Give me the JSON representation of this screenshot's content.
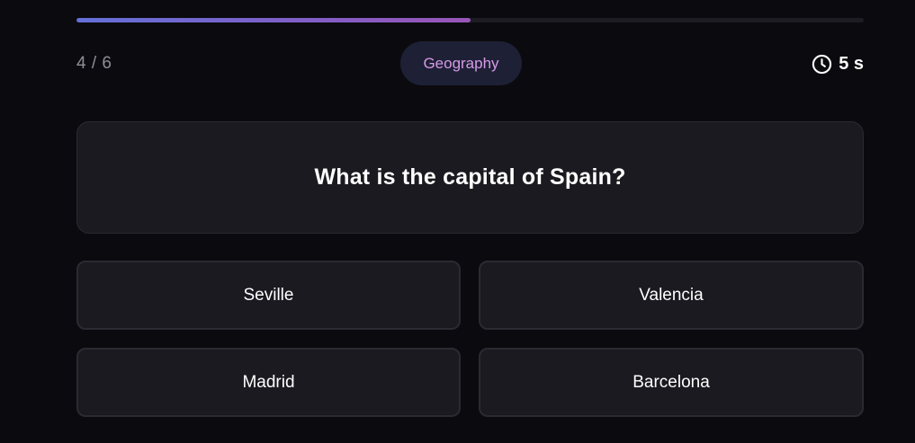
{
  "progress": {
    "current": 4,
    "total": 6,
    "fraction": 0.5
  },
  "header": {
    "counter_text": "4 / 6",
    "category": "Geography",
    "timer_text": "5 s",
    "timer_icon": "clock-icon"
  },
  "question": {
    "text": "What is the capital of Spain?"
  },
  "answers": [
    {
      "label": "Seville"
    },
    {
      "label": "Valencia"
    },
    {
      "label": "Madrid"
    },
    {
      "label": "Barcelona"
    }
  ],
  "colors": {
    "background": "#0b0b0f",
    "card": "#1a1a20",
    "pill_bg": "#1e2036",
    "pill_text": "#d69ae6",
    "progress_start": "#6470d8",
    "progress_end": "#9a55b8"
  }
}
